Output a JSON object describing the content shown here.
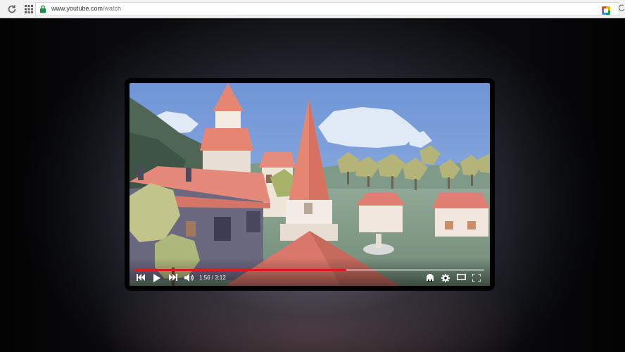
{
  "browser": {
    "url_host": "www.youtube.com",
    "url_path": "/watch",
    "icons": [
      "reload-icon",
      "apps-grid-icon",
      "lock-icon",
      "extension-icon"
    ]
  },
  "player": {
    "current_time": "1:56",
    "duration": "3:12",
    "progress_fraction": 0.604,
    "progress_color": "#e0191c",
    "icons": [
      "previous-icon",
      "play-icon",
      "next-icon",
      "volume-icon",
      "annotations-icon",
      "settings-icon",
      "theater-mode-icon",
      "fullscreen-icon"
    ]
  }
}
